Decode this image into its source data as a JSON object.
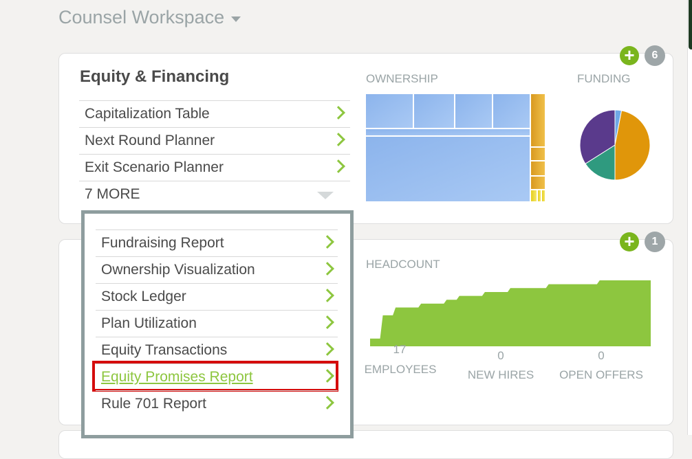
{
  "workspace": {
    "title": "Counsel Workspace",
    "caret_icon": "caret-down-icon"
  },
  "equity_card": {
    "title": "Equity & Financing",
    "add_icon": "+",
    "count": "6",
    "links": [
      {
        "label": "Capitalization Table"
      },
      {
        "label": "Next Round Planner"
      },
      {
        "label": "Exit Scenario Planner"
      }
    ],
    "more_label": "7 MORE",
    "ownership_label": "OWNERSHIP",
    "funding_label": "FUNDING"
  },
  "dropdown": {
    "items": [
      {
        "label": "Fundraising Report"
      },
      {
        "label": "Ownership Visualization"
      },
      {
        "label": "Stock Ledger"
      },
      {
        "label": "Plan Utilization"
      },
      {
        "label": "Equity Transactions"
      },
      {
        "label": "Equity Promises Report",
        "active": true
      },
      {
        "label": "Rule 701 Report"
      }
    ]
  },
  "people_card": {
    "add_icon": "+",
    "count": "1",
    "headcount_label": "HEADCOUNT",
    "stats": [
      {
        "value": "17",
        "label": "EMPLOYEES"
      },
      {
        "value": "0",
        "label": "NEW HIRES"
      },
      {
        "value": "0",
        "label": "OPEN OFFERS"
      }
    ]
  },
  "colors": {
    "accent_green": "#8dc63f",
    "highlight_red": "#d50c0c",
    "treemap_blue": "#8fb5ee",
    "pie_purple": "#5a3a8c",
    "pie_orange": "#e0960a",
    "pie_teal": "#2f9a7f",
    "pie_lightblue": "#6fa8e6"
  },
  "chart_data": [
    {
      "type": "pie",
      "title": "FUNDING",
      "slices": [
        {
          "value": 3,
          "color": "#6fa8e6"
        },
        {
          "value": 47,
          "color": "#e0960a"
        },
        {
          "value": 16,
          "color": "#2f9a7f"
        },
        {
          "value": 34,
          "color": "#5a3a8c"
        }
      ]
    },
    {
      "type": "area",
      "title": "HEADCOUNT",
      "values": [
        2,
        8,
        10,
        10,
        11,
        11,
        12,
        13,
        13,
        14,
        14,
        15,
        15,
        15,
        16,
        16,
        16,
        16,
        17,
        17,
        17,
        17,
        17
      ],
      "color": "#8dc63f"
    }
  ]
}
